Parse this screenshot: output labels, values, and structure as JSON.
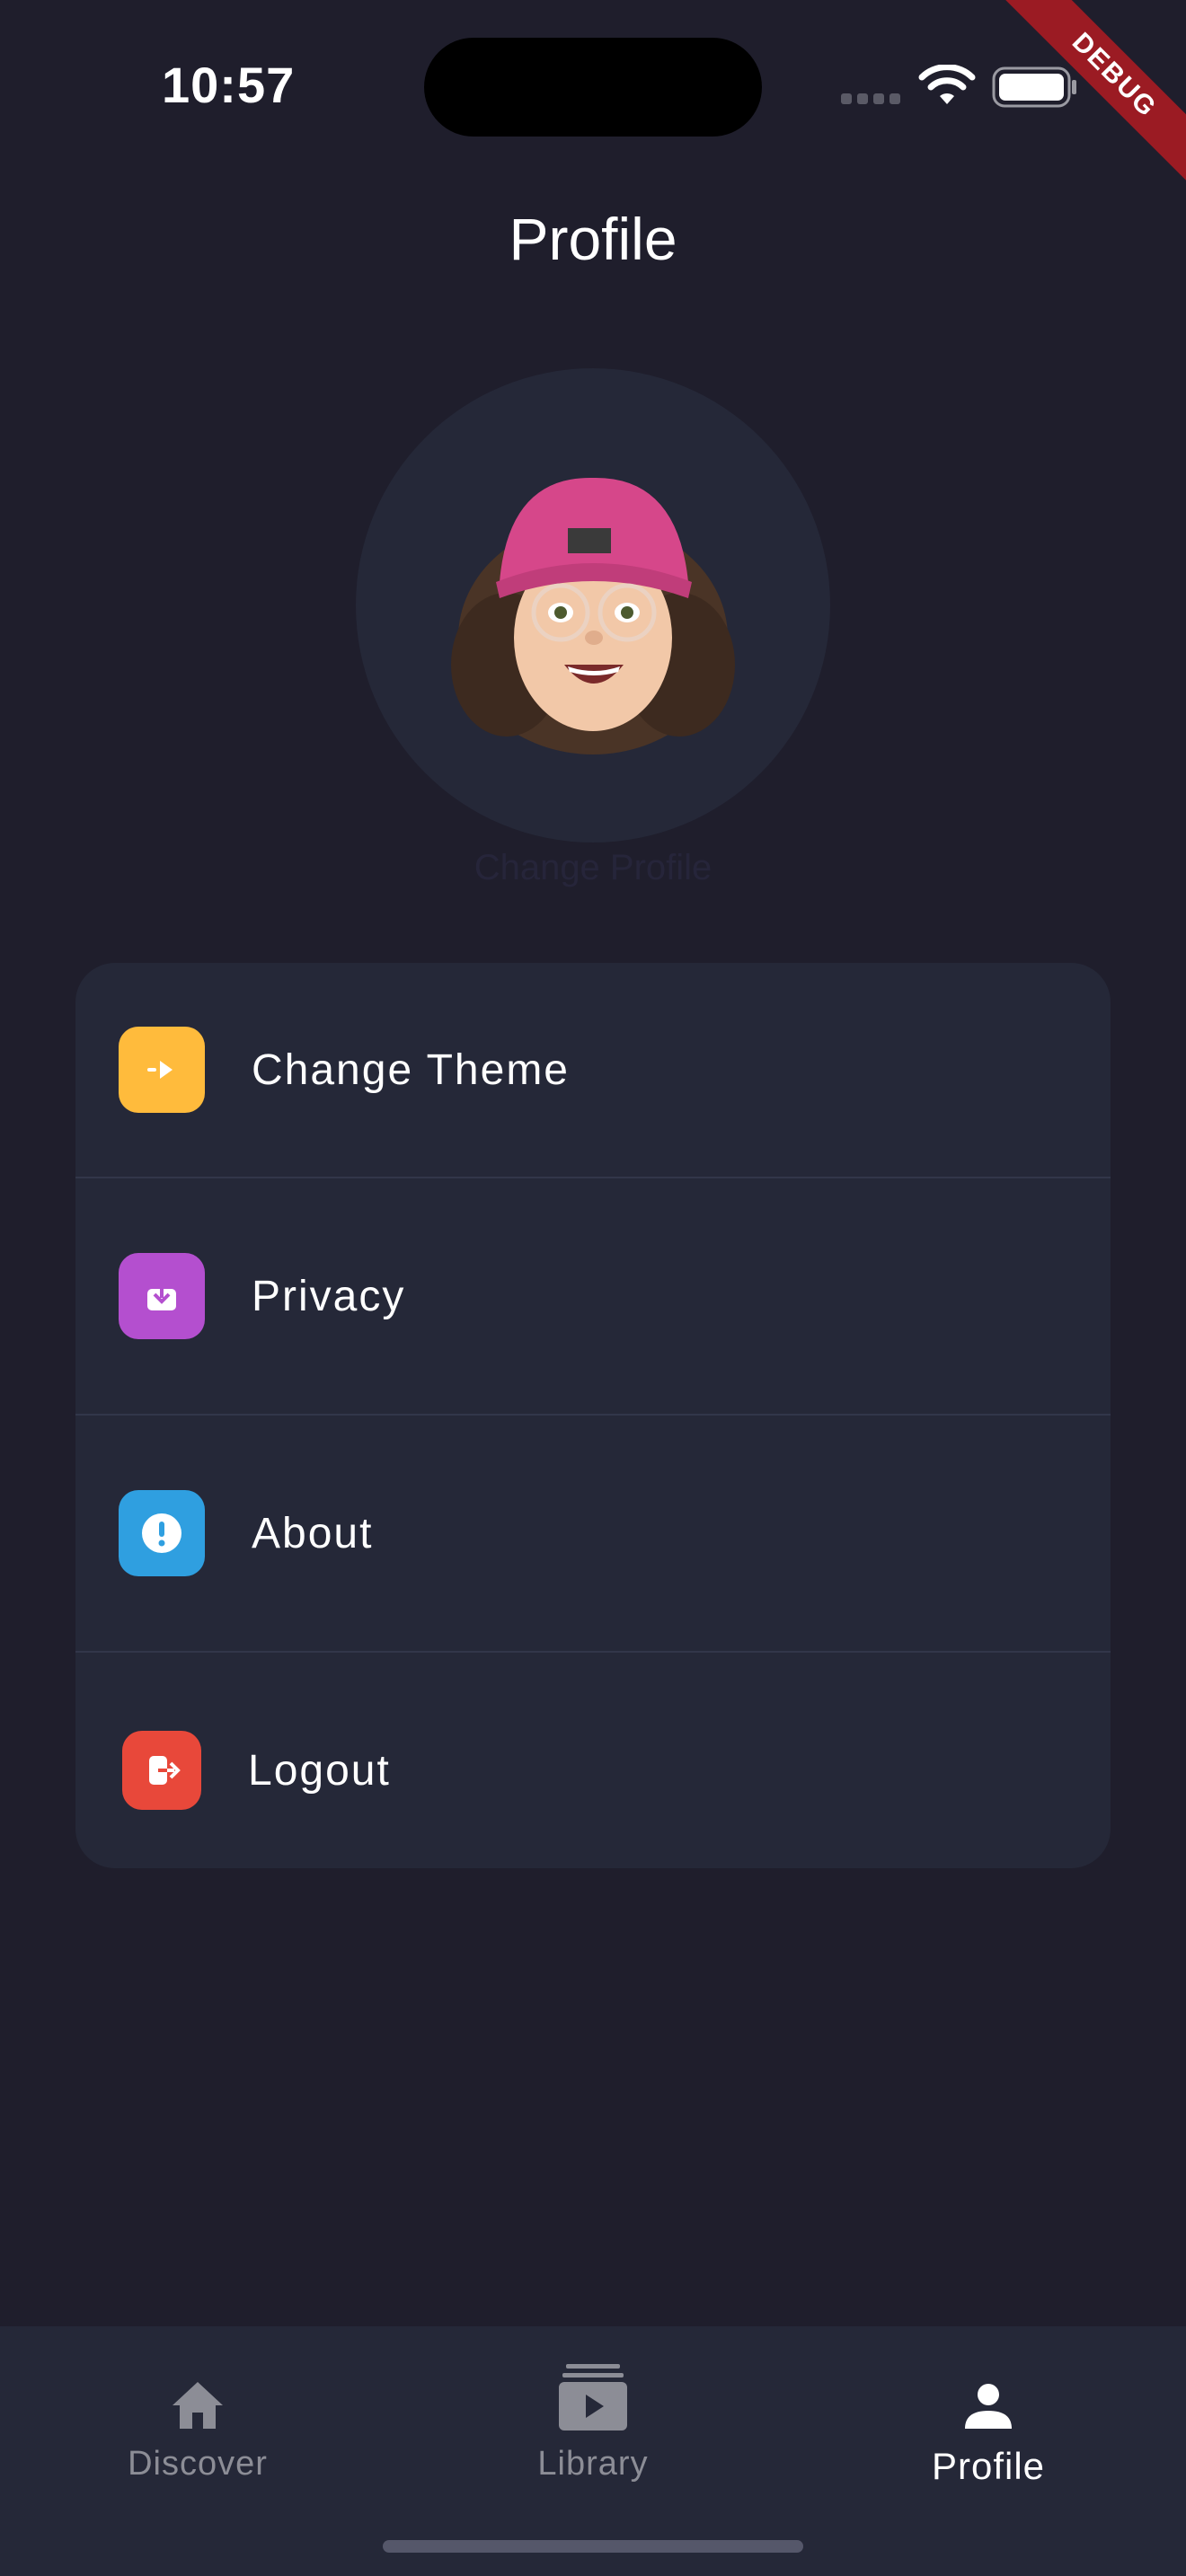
{
  "status_bar": {
    "time": "10:57"
  },
  "debug_banner": "DEBUG",
  "header": {
    "title": "Profile"
  },
  "avatar": {
    "icon": "memoji-avatar",
    "caption": "Change Profile"
  },
  "menu": {
    "items": [
      {
        "label": "Change Theme",
        "icon": "theme-icon",
        "color": "#ffbb3c"
      },
      {
        "label": "Privacy",
        "icon": "privacy-icon",
        "color": "#b44fcf"
      },
      {
        "label": "About",
        "icon": "info-icon",
        "color": "#2f9fe0"
      },
      {
        "label": "Logout",
        "icon": "logout-icon",
        "color": "#e8483a"
      }
    ]
  },
  "bottom_nav": {
    "items": [
      {
        "label": "Discover",
        "icon": "home-icon",
        "active": false
      },
      {
        "label": "Library",
        "icon": "library-icon",
        "active": false
      },
      {
        "label": "Profile",
        "icon": "person-icon",
        "active": true
      }
    ]
  },
  "colors": {
    "background": "#1f1e2c",
    "card": "#252838",
    "inactive_text": "#8c8d96",
    "accent_text": "#ffffff"
  }
}
